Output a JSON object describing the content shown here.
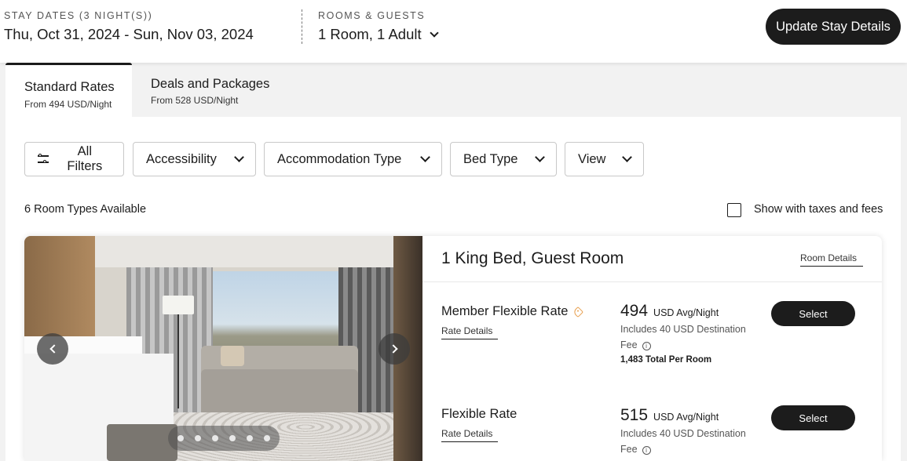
{
  "header": {
    "stay_dates_label": "STAY DATES (3 NIGHT(S))",
    "stay_dates_value": "Thu, Oct 31, 2024 - Sun, Nov 03, 2024",
    "rooms_guests_label": "ROOMS & GUESTS",
    "rooms_guests_value": "1 Room, 1 Adult",
    "update_button": "Update Stay Details"
  },
  "tabs": [
    {
      "title": "Standard Rates",
      "subtitle": "From 494 USD/Night",
      "active": true
    },
    {
      "title": "Deals and Packages",
      "subtitle": "From 528 USD/Night",
      "active": false
    }
  ],
  "filters": {
    "all_filters": "All Filters",
    "accessibility": "Accessibility",
    "accommodation_type": "Accommodation Type",
    "bed_type": "Bed Type",
    "view": "View"
  },
  "results": {
    "count_text": "6 Room Types Available",
    "taxes_toggle_label": "Show with taxes and fees",
    "taxes_toggle_checked": false
  },
  "room": {
    "title": "1 King Bed, Guest Room",
    "details_link": "Room Details",
    "carousel_slides": 6,
    "rates": [
      {
        "name": "Member Flexible Rate",
        "details_link": "Rate Details",
        "price": "494",
        "unit": "USD Avg/Night",
        "note": "Includes 40 USD Destination Fee",
        "total": "1,483 Total Per Room",
        "select": "Select"
      },
      {
        "name": "Flexible Rate",
        "details_link": "Rate Details",
        "price": "515",
        "unit": "USD Avg/Night",
        "note": "Includes 40 USD Destination Fee",
        "select": "Select"
      }
    ]
  }
}
